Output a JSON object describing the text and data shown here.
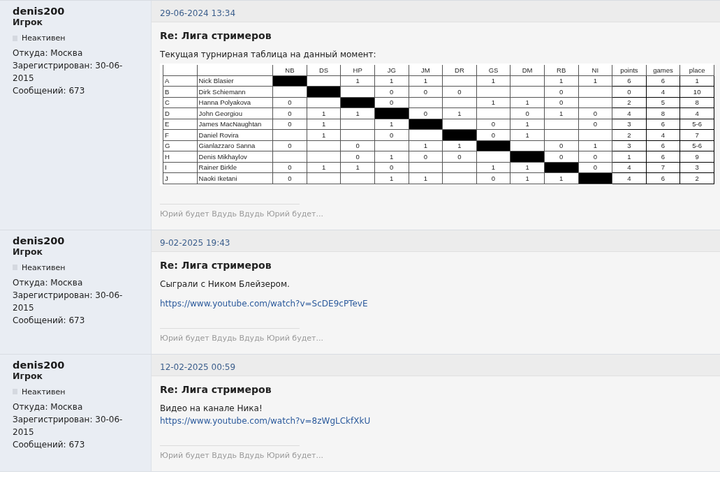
{
  "posts": [
    {
      "author": {
        "name": "denis200",
        "rank": "Игрок",
        "online": false,
        "status": "Неактивен",
        "location": "Откуда: Москва",
        "registered": "Зарегистрирован: 30-06-2015",
        "messages": "Сообщений: 673"
      },
      "date": "29-06-2024 13:34",
      "title": "Re: Лига стримеров",
      "paragraphs": [
        [
          {
            "kind": "text",
            "text": "Текущая турнирная таблица на данный момент:"
          }
        ]
      ],
      "standings": {
        "columns": [
          "NB",
          "DS",
          "HP",
          "JG",
          "JM",
          "DR",
          "GS",
          "DM",
          "RB",
          "NI",
          "points",
          "games",
          "place"
        ],
        "rows": [
          {
            "letter": "A",
            "name": "Nick Blasier",
            "results": [
              {
                "kind": "self"
              },
              {
                "kind": "empty"
              },
              {
                "kind": "score",
                "text": "1"
              },
              {
                "kind": "score",
                "text": "1"
              },
              {
                "kind": "score",
                "text": "1"
              },
              {
                "kind": "empty"
              },
              {
                "kind": "score",
                "text": "1"
              },
              {
                "kind": "empty"
              },
              {
                "kind": "score",
                "text": "1"
              },
              {
                "kind": "score",
                "text": "1"
              }
            ],
            "points": "6",
            "games": "6",
            "place": "1"
          },
          {
            "letter": "B",
            "name": "Dirk Schiemann",
            "results": [
              {
                "kind": "empty"
              },
              {
                "kind": "self"
              },
              {
                "kind": "empty"
              },
              {
                "kind": "score",
                "text": "0"
              },
              {
                "kind": "score",
                "text": "0"
              },
              {
                "kind": "score",
                "text": "0"
              },
              {
                "kind": "empty"
              },
              {
                "kind": "empty"
              },
              {
                "kind": "score",
                "text": "0"
              },
              {
                "kind": "empty"
              }
            ],
            "points": "0",
            "games": "4",
            "place": "10"
          },
          {
            "letter": "C",
            "name": "Hanna Polyakova",
            "results": [
              {
                "kind": "score",
                "text": "0"
              },
              {
                "kind": "empty"
              },
              {
                "kind": "self"
              },
              {
                "kind": "score",
                "text": "0"
              },
              {
                "kind": "empty"
              },
              {
                "kind": "empty"
              },
              {
                "kind": "score",
                "text": "1"
              },
              {
                "kind": "score",
                "text": "1"
              },
              {
                "kind": "score",
                "text": "0"
              },
              {
                "kind": "empty"
              }
            ],
            "points": "2",
            "games": "5",
            "place": "8"
          },
          {
            "letter": "D",
            "name": "John Georgiou",
            "results": [
              {
                "kind": "score",
                "text": "0"
              },
              {
                "kind": "score",
                "text": "1"
              },
              {
                "kind": "score",
                "text": "1"
              },
              {
                "kind": "self"
              },
              {
                "kind": "score",
                "text": "0"
              },
              {
                "kind": "score",
                "text": "1"
              },
              {
                "kind": "empty"
              },
              {
                "kind": "score",
                "text": "0"
              },
              {
                "kind": "score",
                "text": "1"
              },
              {
                "kind": "score",
                "text": "0"
              }
            ],
            "points": "4",
            "games": "8",
            "place": "4"
          },
          {
            "letter": "E",
            "name": "James MacNaughtan",
            "results": [
              {
                "kind": "score",
                "text": "0"
              },
              {
                "kind": "score",
                "text": "1"
              },
              {
                "kind": "empty"
              },
              {
                "kind": "score",
                "text": "1"
              },
              {
                "kind": "self"
              },
              {
                "kind": "empty"
              },
              {
                "kind": "score",
                "text": "0"
              },
              {
                "kind": "score",
                "text": "1"
              },
              {
                "kind": "empty"
              },
              {
                "kind": "score",
                "text": "0"
              }
            ],
            "points": "3",
            "games": "6",
            "place": "5-6"
          },
          {
            "letter": "F",
            "name": "Daniel Rovira",
            "results": [
              {
                "kind": "empty"
              },
              {
                "kind": "score",
                "text": "1"
              },
              {
                "kind": "empty"
              },
              {
                "kind": "score",
                "text": "0"
              },
              {
                "kind": "empty"
              },
              {
                "kind": "self"
              },
              {
                "kind": "score",
                "text": "0"
              },
              {
                "kind": "score",
                "text": "1"
              },
              {
                "kind": "empty"
              },
              {
                "kind": "empty"
              }
            ],
            "points": "2",
            "games": "4",
            "place": "7"
          },
          {
            "letter": "G",
            "name": "Gianlazzaro Sanna",
            "results": [
              {
                "kind": "score",
                "text": "0"
              },
              {
                "kind": "empty"
              },
              {
                "kind": "score",
                "text": "0"
              },
              {
                "kind": "empty"
              },
              {
                "kind": "score",
                "text": "1"
              },
              {
                "kind": "score",
                "text": "1"
              },
              {
                "kind": "self"
              },
              {
                "kind": "empty"
              },
              {
                "kind": "score",
                "text": "0"
              },
              {
                "kind": "score",
                "text": "1"
              }
            ],
            "points": "3",
            "games": "6",
            "place": "5-6"
          },
          {
            "letter": "H",
            "name": "Denis Mikhaylov",
            "results": [
              {
                "kind": "empty"
              },
              {
                "kind": "empty"
              },
              {
                "kind": "score",
                "text": "0"
              },
              {
                "kind": "score",
                "text": "1"
              },
              {
                "kind": "score",
                "text": "0"
              },
              {
                "kind": "score",
                "text": "0"
              },
              {
                "kind": "empty"
              },
              {
                "kind": "self"
              },
              {
                "kind": "score",
                "text": "0"
              },
              {
                "kind": "score",
                "text": "0"
              }
            ],
            "points": "1",
            "games": "6",
            "place": "9"
          },
          {
            "letter": "I",
            "name": "Rainer Birkle",
            "results": [
              {
                "kind": "score",
                "text": "0"
              },
              {
                "kind": "score",
                "text": "1"
              },
              {
                "kind": "score",
                "text": "1"
              },
              {
                "kind": "score",
                "text": "0"
              },
              {
                "kind": "empty"
              },
              {
                "kind": "empty"
              },
              {
                "kind": "score",
                "text": "1"
              },
              {
                "kind": "score",
                "text": "1"
              },
              {
                "kind": "self"
              },
              {
                "kind": "score",
                "text": "0"
              }
            ],
            "points": "4",
            "games": "7",
            "place": "3"
          },
          {
            "letter": "J",
            "name": "Naoki Iketani",
            "results": [
              {
                "kind": "score",
                "text": "0"
              },
              {
                "kind": "empty"
              },
              {
                "kind": "empty"
              },
              {
                "kind": "score",
                "text": "1"
              },
              {
                "kind": "score",
                "text": "1"
              },
              {
                "kind": "empty"
              },
              {
                "kind": "score",
                "text": "0"
              },
              {
                "kind": "score",
                "text": "1"
              },
              {
                "kind": "score",
                "text": "1"
              },
              {
                "kind": "self"
              }
            ],
            "points": "4",
            "games": "6",
            "place": "2"
          }
        ]
      },
      "signature": "Юрий будет Вдудь Вдудь Юрий будет..."
    },
    {
      "author": {
        "name": "denis200",
        "rank": "Игрок",
        "online": false,
        "status": "Неактивен",
        "location": "Откуда: Москва",
        "registered": "Зарегистрирован: 30-06-2015",
        "messages": "Сообщений: 673"
      },
      "date": "9-02-2025 19:43",
      "title": "Re: Лига стримеров",
      "paragraphs": [
        [
          {
            "kind": "text",
            "text": "Сыграли с Ником Блейзером."
          }
        ],
        [
          {
            "kind": "link",
            "text": "https://www.youtube.com/watch?v=ScDE9cPTevE"
          }
        ]
      ],
      "signature": "Юрий будет Вдудь Вдудь Юрий будет..."
    },
    {
      "author": {
        "name": "denis200",
        "rank": "Игрок",
        "online": false,
        "status": "Неактивен",
        "location": "Откуда: Москва",
        "registered": "Зарегистрирован: 30-06-2015",
        "messages": "Сообщений: 673"
      },
      "date": "12-02-2025 00:59",
      "title": "Re: Лига стримеров",
      "paragraphs": [
        [
          {
            "kind": "text",
            "text": "Видео на канале Ника!"
          },
          {
            "kind": "link",
            "text": "https://www.youtube.com/watch?v=8zWgLCkfXkU"
          }
        ]
      ],
      "signature": "Юрий будет Вдудь Вдудь Юрий будет..."
    }
  ]
}
